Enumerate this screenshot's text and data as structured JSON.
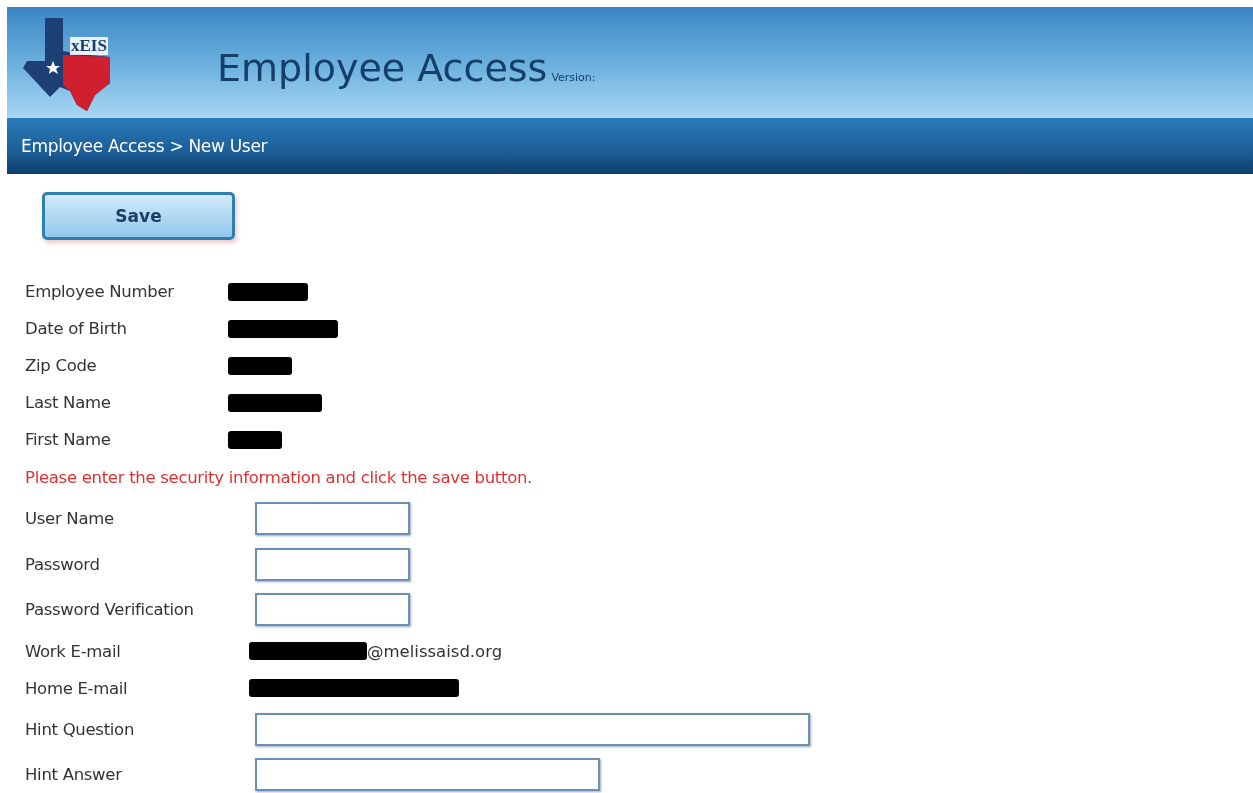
{
  "header": {
    "logo_text": "xEIS",
    "title": "Employee Access",
    "version_label": "Version:"
  },
  "breadcrumb": "Employee Access > New User",
  "save_button": "Save",
  "fields": [
    {
      "label": "Employee Number",
      "kind": "redacted"
    },
    {
      "label": "Date of Birth",
      "kind": "redacted"
    },
    {
      "label": "Zip Code",
      "kind": "redacted"
    },
    {
      "label": "Last Name",
      "kind": "redacted"
    },
    {
      "label": "First Name",
      "kind": "redacted"
    }
  ],
  "message": "Please enter the security information and click the save button.",
  "security_fields": [
    {
      "label": "User Name",
      "kind": "input"
    },
    {
      "label": "Password",
      "kind": "input"
    },
    {
      "label": "Password Verification",
      "kind": "input"
    },
    {
      "label": "Work E-mail",
      "kind": "redacted",
      "suffix": "@melissaisd.org"
    },
    {
      "label": "Home E-mail",
      "kind": "redacted"
    },
    {
      "label": "Hint Question",
      "kind": "input-long"
    },
    {
      "label": "Hint Answer",
      "kind": "input-medium"
    }
  ]
}
